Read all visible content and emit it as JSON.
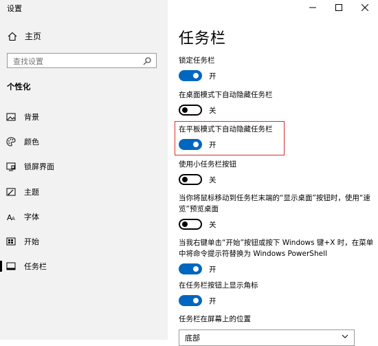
{
  "window": {
    "app_title": "设置",
    "controls": [
      "minimize-icon",
      "maximize-icon",
      "close-icon"
    ]
  },
  "sidebar": {
    "home_label": "主页",
    "search_placeholder": "查找设置",
    "section_title": "个性化",
    "items": [
      {
        "label": "背景",
        "icon": "image-icon"
      },
      {
        "label": "颜色",
        "icon": "palette-icon"
      },
      {
        "label": "锁屏界面",
        "icon": "lock-screen-icon"
      },
      {
        "label": "主题",
        "icon": "theme-icon"
      },
      {
        "label": "字体",
        "icon": "font-icon"
      },
      {
        "label": "开始",
        "icon": "start-icon"
      },
      {
        "label": "任务栏",
        "icon": "taskbar-icon",
        "active": true
      }
    ]
  },
  "main": {
    "title": "任务栏",
    "settings": [
      {
        "label": "锁定任务栏",
        "state": "开",
        "on": true
      },
      {
        "label": "在桌面模式下自动隐藏任务栏",
        "state": "关",
        "on": false
      },
      {
        "label": "在平板模式下自动隐藏任务栏",
        "state": "开",
        "on": true,
        "highlighted": true
      },
      {
        "label": "使用小任务栏按钮",
        "state": "关",
        "on": false
      },
      {
        "label": "当你将鼠标移动到任务栏末端的“显示桌面”按钮时，使用“速览”预览桌面",
        "state": "关",
        "on": false
      },
      {
        "label": "当我右键单击“开始”按钮或按下 Windows 键+X 时，在菜单中将命令提示符替换为 Windows PowerShell",
        "state": "开",
        "on": true
      },
      {
        "label": "在任务栏按钮上显示角标",
        "state": "开",
        "on": true
      }
    ],
    "position_label": "任务栏在屏幕上的位置",
    "position_value": "底部"
  },
  "colors": {
    "accent": "#0067c0",
    "highlight_border": "#d92b2b",
    "sidebar_bg": "#f2f2f2"
  }
}
